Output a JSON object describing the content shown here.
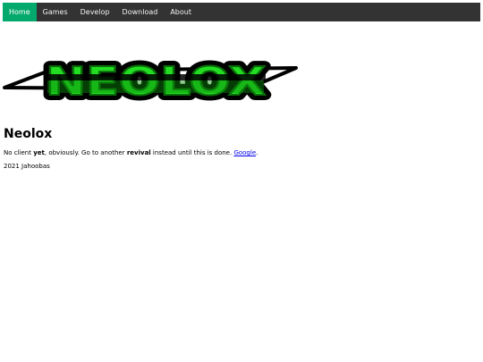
{
  "nav": {
    "items": [
      {
        "label": "Home"
      },
      {
        "label": "Games"
      },
      {
        "label": "Develop"
      },
      {
        "label": "Download"
      },
      {
        "label": "About"
      }
    ],
    "active_index": 0
  },
  "logo": {
    "text": "NEOLOX",
    "icon": "neolox-logo"
  },
  "page": {
    "title": "Neolox",
    "intro": {
      "t1": "No client ",
      "b1": "yet",
      "t2": ", obviously. Go to another ",
      "b2": "revival",
      "t3": " instead until this is done. ",
      "link": "Google",
      "t4": "."
    },
    "footer": "2021 Jahoobas"
  },
  "colors": {
    "nav_bg": "#333333",
    "nav_active": "#04aa6d",
    "logo_fill": "#22dd22",
    "logo_outline": "#000000",
    "link": "#0000ee"
  }
}
